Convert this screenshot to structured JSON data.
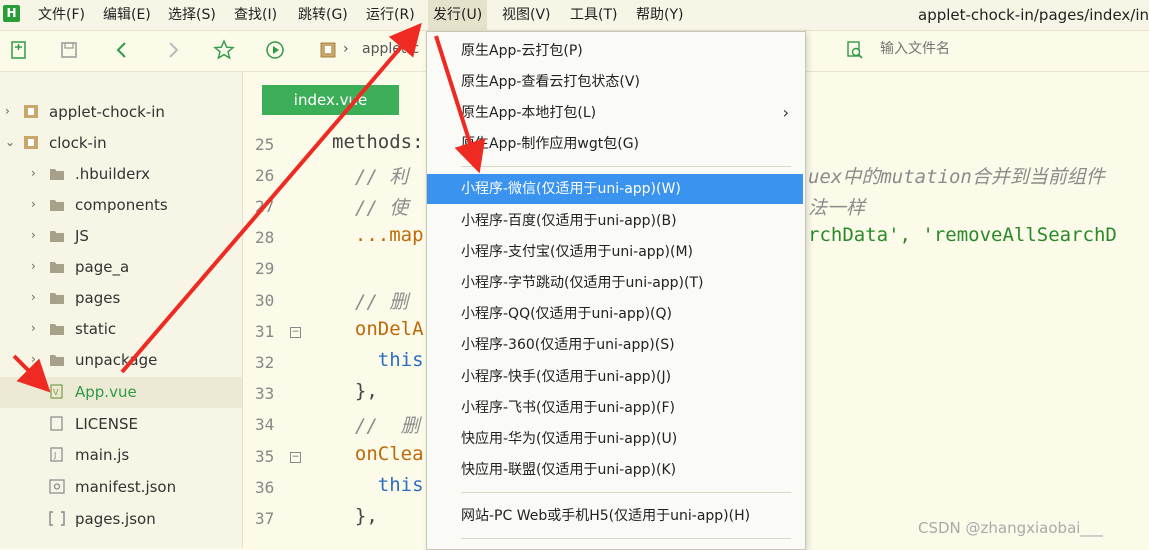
{
  "menubar": {
    "logo": "H",
    "items": [
      "文件(F)",
      "编辑(E)",
      "选择(S)",
      "查找(I)",
      "跳转(G)",
      "运行(R)",
      "发行(U)",
      "视图(V)",
      "工具(T)",
      "帮助(Y)"
    ],
    "title": "applet-chock-in/pages/index/inc"
  },
  "toolbar": {
    "crumb": "applet-c",
    "search_placeholder": "输入文件名"
  },
  "sidebar": {
    "items": [
      {
        "label": "applet-chock-in",
        "chev": "›"
      },
      {
        "label": "clock-in",
        "chev": "⌄"
      },
      {
        "label": ".hbuilderx",
        "chev": "›"
      },
      {
        "label": "components",
        "chev": "›"
      },
      {
        "label": "JS",
        "chev": "›"
      },
      {
        "label": "page_a",
        "chev": "›"
      },
      {
        "label": "pages",
        "chev": "›"
      },
      {
        "label": "static",
        "chev": "›"
      },
      {
        "label": "unpackage",
        "chev": "›"
      },
      {
        "label": "App.vue",
        "chev": ""
      },
      {
        "label": "LICENSE",
        "chev": ""
      },
      {
        "label": "main.js",
        "chev": ""
      },
      {
        "label": "manifest.json",
        "chev": ""
      },
      {
        "label": "pages.json",
        "chev": ""
      }
    ]
  },
  "editor": {
    "tab": "index.vue",
    "line_numbers": [
      "25",
      "26",
      "27",
      "28",
      "29",
      "30",
      "31",
      "32",
      "33",
      "34",
      "35",
      "36",
      "37"
    ],
    "code": {
      "l25": "methods:",
      "l26a": "  // 利",
      "l26b": "uex中的mutation合并到当前组件",
      "l27a": "  // 使",
      "l27b": "法一样",
      "l28a": "  ...map",
      "l28b": "rchData', 'removeAllSearchD",
      "l30": "  // 删",
      "l31": "  onDelA",
      "l32": "    this",
      "l33": "  },",
      "l34": "  //  删",
      "l35": "  onClea",
      "l36": "    this",
      "l37": "  },"
    }
  },
  "dropdown": {
    "items": [
      "原生App-云打包(P)",
      "原生App-查看云打包状态(V)",
      "原生App-本地打包(L)",
      "原生App-制作应用wgt包(G)",
      "小程序-微信(仅适用于uni-app)(W)",
      "小程序-百度(仅适用于uni-app)(B)",
      "小程序-支付宝(仅适用于uni-app)(M)",
      "小程序-字节跳动(仅适用于uni-app)(T)",
      "小程序-QQ(仅适用于uni-app)(Q)",
      "小程序-360(仅适用于uni-app)(S)",
      "小程序-快手(仅适用于uni-app)(J)",
      "小程序-飞书(仅适用于uni-app)(F)",
      "快应用-华为(仅适用于uni-app)(U)",
      "快应用-联盟(仅适用于uni-app)(K)",
      "网站-PC Web或手机H5(仅适用于uni-app)(H)"
    ],
    "submenu_arrow": "›"
  },
  "watermark": "CSDN @zhangxiaobai___",
  "colors": {
    "accent_green": "#3dae58",
    "highlight_blue": "#3b93f0",
    "annotation_red": "#ee2a22"
  }
}
